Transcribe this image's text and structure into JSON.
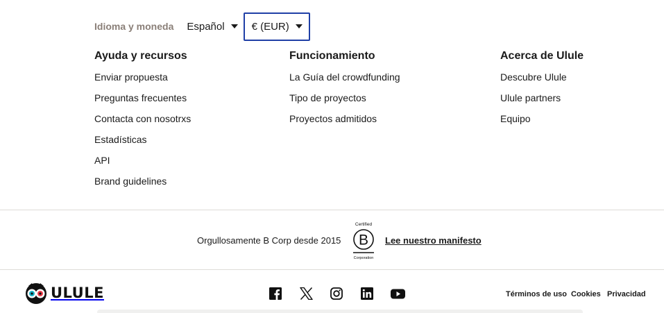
{
  "language_currency": {
    "title": "Idioma y moneda",
    "language": "Español",
    "currency": "€ (EUR)"
  },
  "columns": [
    {
      "heading": "Ayuda y recursos",
      "links": [
        "Enviar propuesta",
        "Preguntas frecuentes",
        "Contacta con nosotrxs",
        "Estadísticas",
        "API",
        "Brand guidelines"
      ]
    },
    {
      "heading": "Funcionamiento",
      "links": [
        "La Guía del crowdfunding",
        "Tipo de proyectos",
        "Proyectos admitidos"
      ]
    },
    {
      "heading": "Acerca de Ulule",
      "links": [
        "Descubre Ulule",
        "Ulule partners",
        "Equipo"
      ]
    }
  ],
  "bcorp": {
    "text": "Orgullosamente B Corp desde 2015",
    "logo_top": "Certified",
    "logo_bottom": "Corporation",
    "link": "Lee nuestro manifesto"
  },
  "footer": {
    "logo_text": "ULULE",
    "social_icons": [
      "facebook-icon",
      "x-icon",
      "instagram-icon",
      "linkedin-icon",
      "youtube-icon"
    ],
    "legal": [
      "Términos de uso",
      "Cookies",
      "Privacidad"
    ]
  },
  "colors": {
    "currency_focus_border": "#1f3fa6",
    "muted_title": "#8a7f78",
    "divider": "#dedcd8"
  }
}
